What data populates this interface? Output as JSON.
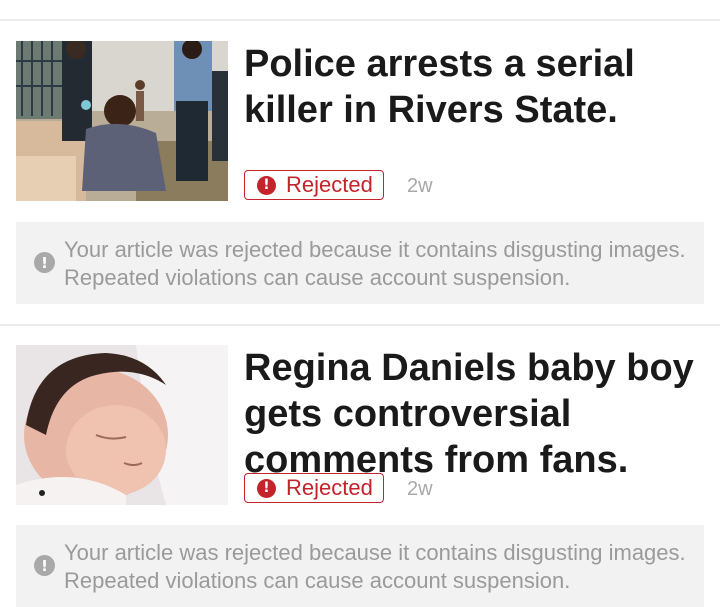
{
  "articles": [
    {
      "title": "Police arrests a serial killer in Rivers State.",
      "status": "Rejected",
      "age": "2w",
      "notice": "Your article was rejected because it contains disgusting images. Repeated violations can cause account suspension.",
      "thumbnail": "photo-police-arrest-scene"
    },
    {
      "title": "Regina Daniels baby boy gets controversial comments from fans.",
      "status": "Rejected",
      "age": "2w",
      "notice": "Your article was rejected because it contains disgusting images. Repeated violations can cause account suspension.",
      "thumbnail": "photo-sleeping-baby"
    }
  ],
  "icons": {
    "status_icon": "error-icon",
    "notice_icon": "info-icon"
  },
  "colors": {
    "rejected": "#c4232b",
    "muted": "#9a9a9a",
    "notice_bg": "#f2f2f2"
  }
}
